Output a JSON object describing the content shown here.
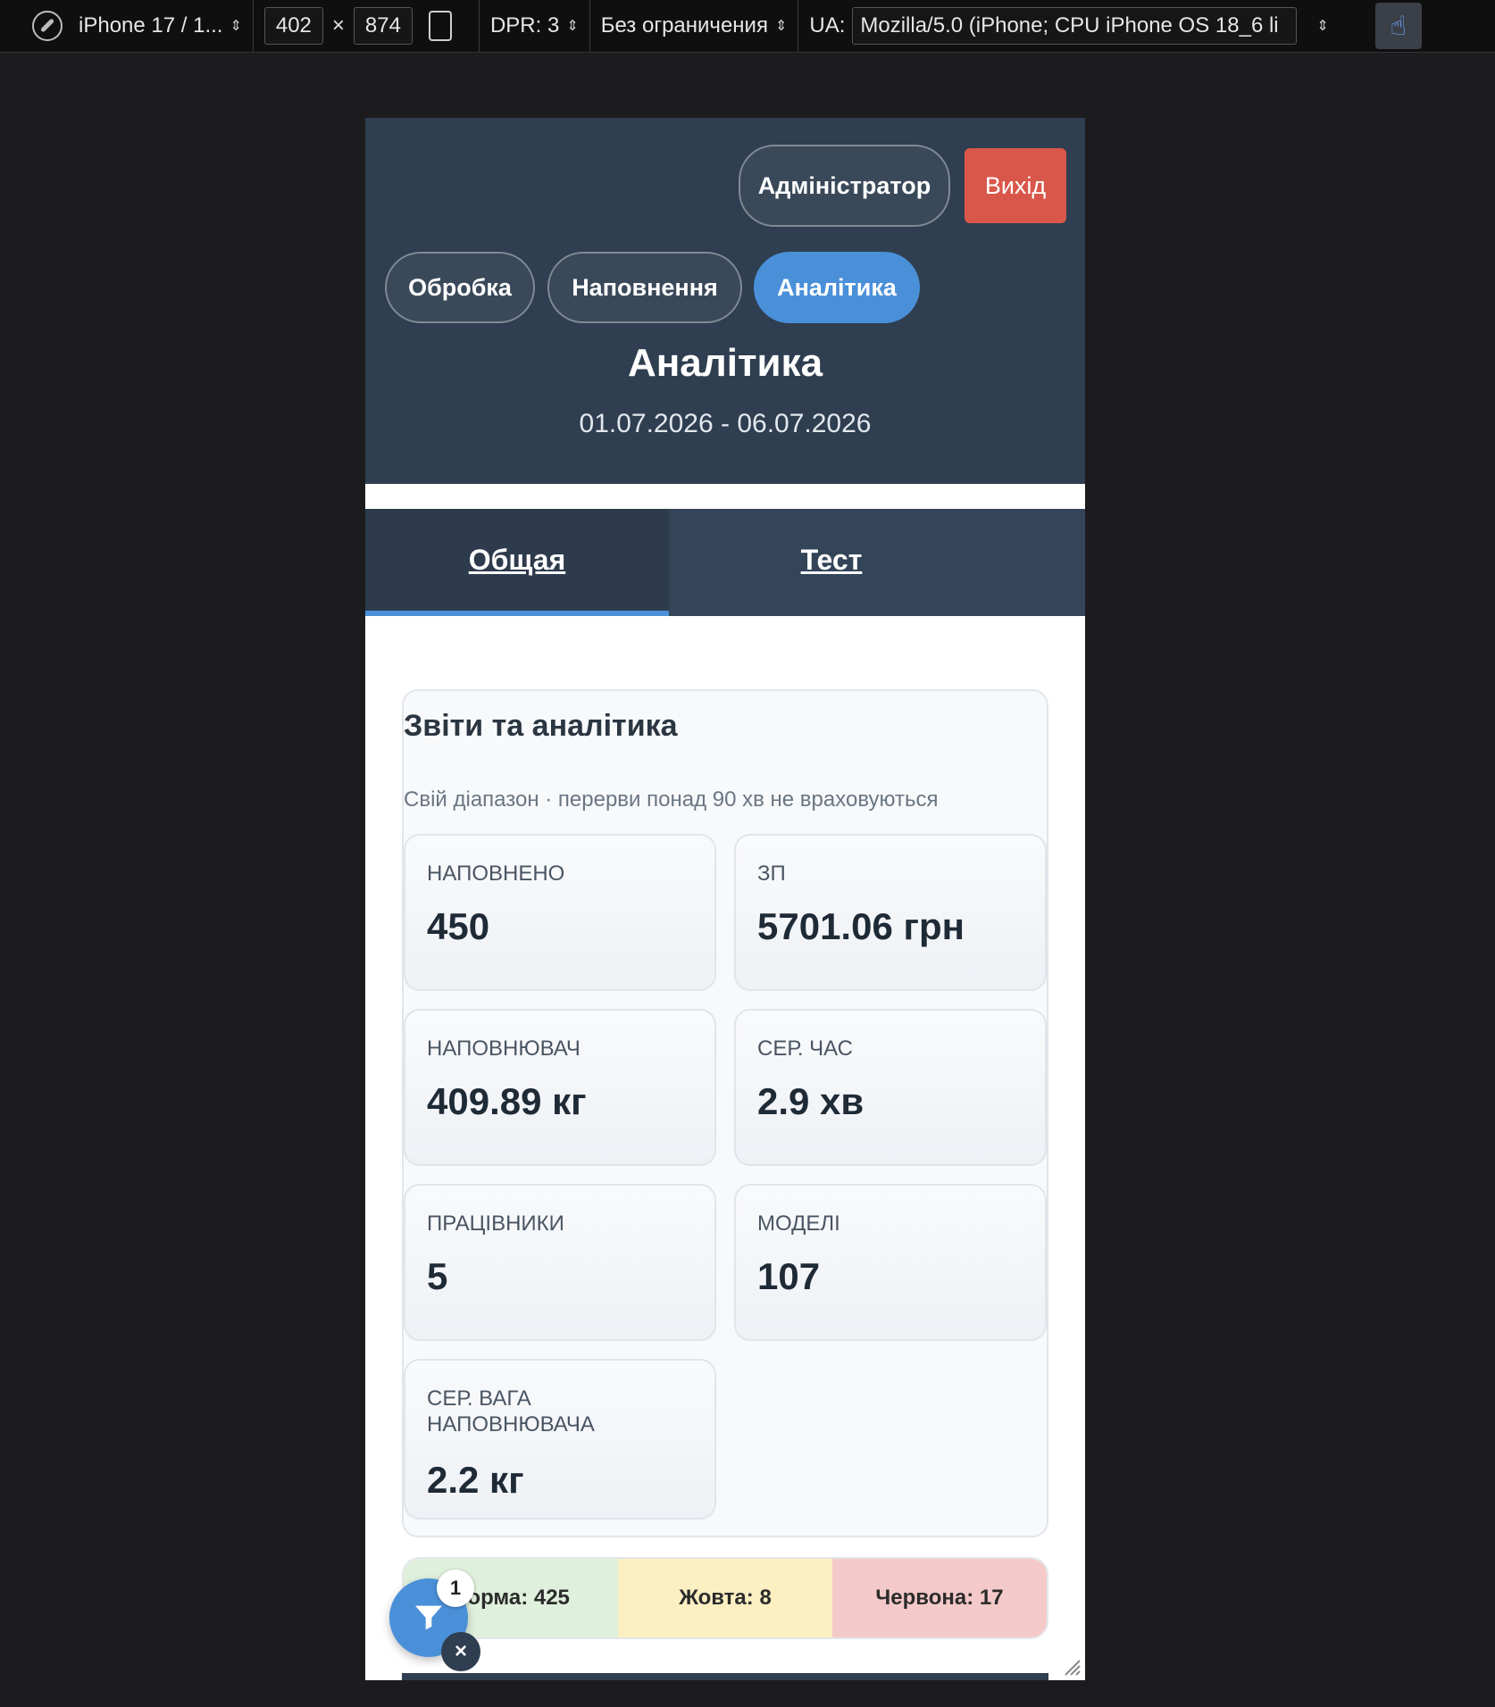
{
  "devtools": {
    "device": "iPhone 17 / 1...",
    "width": "402",
    "times": "×",
    "height": "874",
    "dpr": "DPR: 3",
    "throttle": "Без ограничения",
    "ua_label": "UA:",
    "ua_value": "Mozilla/5.0 (iPhone; CPU iPhone OS 18_6 li"
  },
  "header": {
    "admin_label": "Адміністратор",
    "logout_label": "Вихід",
    "nav": [
      "Обробка",
      "Наповнення",
      "Аналітика"
    ],
    "title": "Аналітика",
    "date_range": "01.07.2026 - 06.07.2026"
  },
  "tabs": [
    "Общая",
    "Тест"
  ],
  "report": {
    "title": "Звіти та аналітика",
    "subtitle": "Свій діапазон · перерви понад 90 хв не враховуються",
    "stats": [
      {
        "label": "Наповнено",
        "value": "450"
      },
      {
        "label": "ЗП",
        "value": "5701.06 грн"
      },
      {
        "label": "Наповнювач",
        "value": "409.89 кг"
      },
      {
        "label": "Сер. час",
        "value": "2.9 хв"
      },
      {
        "label": "Працівники",
        "value": "5"
      },
      {
        "label": "Моделі",
        "value": "107"
      },
      {
        "label": "Сер. вага наповнювача",
        "value": "2.2 кг"
      }
    ]
  },
  "status": {
    "green": "Норма: 425",
    "yellow": "Жовта: 8",
    "red": "Червона: 17"
  },
  "filter": {
    "badge": "1",
    "close": "×"
  },
  "colors": {
    "accent": "#4a90d9",
    "header_bg": "#2f3e50",
    "logout": "#d9574a"
  }
}
